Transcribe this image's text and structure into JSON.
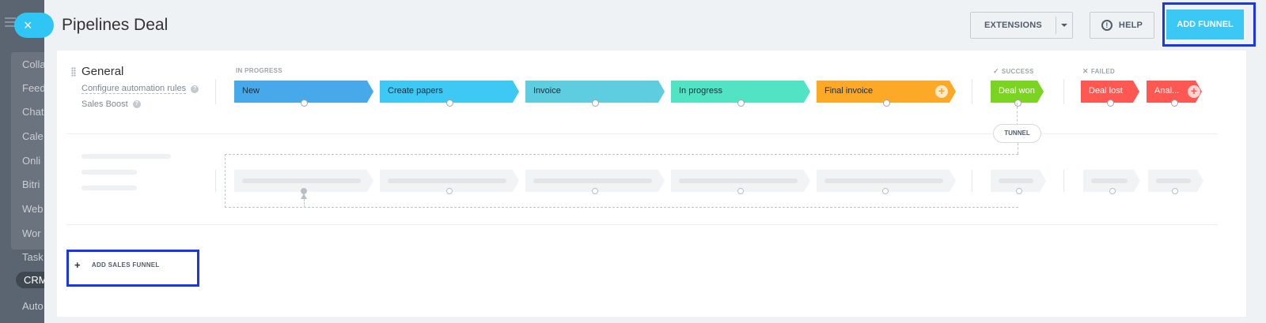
{
  "background": {
    "menu": [
      "Colla",
      "Feed",
      "Chat",
      "Cale",
      "Onli",
      "Bitri",
      "Web",
      "Wor",
      "Task",
      "CRM",
      "Auto"
    ]
  },
  "header": {
    "title": "Pipelines Deal",
    "extensions_label": "EXTENSIONS",
    "help_label": "HELP",
    "help_glyph": "!",
    "add_funnel_label": "ADD FUNNEL",
    "close_glyph": "×"
  },
  "funnel": {
    "name": "General",
    "links": [
      "Configure automation rules",
      "Sales Boost"
    ],
    "help_glyph": "?",
    "groups": {
      "in_progress": "IN PROGRESS",
      "success": "SUCCESS",
      "failed": "FAILED"
    },
    "stages": [
      {
        "name": "New",
        "color": "#47a9ea"
      },
      {
        "name": "Create papers",
        "color": "#3ec8f4"
      },
      {
        "name": "Invoice",
        "color": "#5ecddf"
      },
      {
        "name": "In progress",
        "color": "#52e3c4"
      },
      {
        "name": "Final invoice",
        "color": "#fba927"
      }
    ],
    "success_stage": {
      "name": "Deal won",
      "color": "#7bd322"
    },
    "failed_stages": [
      {
        "name": "Deal lost",
        "color": "#ff5752"
      },
      {
        "name": "Anal...",
        "color": "#ff5752"
      }
    ],
    "plus_glyph": "+",
    "tunnel_label": "TUNNEL"
  },
  "add_sales_funnel": {
    "label": "ADD SALES FUNNEL",
    "glyph": "+"
  }
}
